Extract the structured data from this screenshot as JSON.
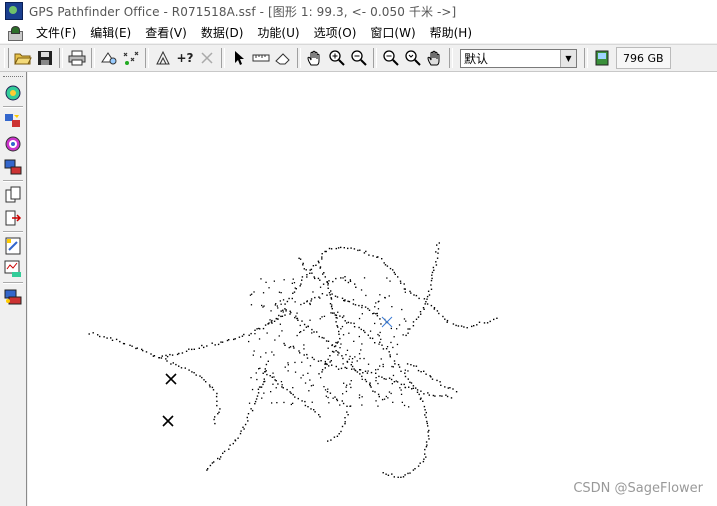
{
  "window": {
    "title": "GPS Pathfinder Office  - R071518A.ssf - [图形 1: 99.3, <- 0.050 千米 ->]"
  },
  "menu": {
    "items": [
      "文件(F)",
      "编辑(E)",
      "查看(V)",
      "数据(D)",
      "功能(U)",
      "选项(O)",
      "窗口(W)",
      "帮助(H)"
    ]
  },
  "toolbar": {
    "buttons": [
      {
        "icon": "open-folder-icon"
      },
      {
        "icon": "save-icon"
      },
      {
        "icon": "print-icon"
      },
      {
        "icon": "layers-icon"
      },
      {
        "icon": "waypoints-icon"
      },
      {
        "icon": "feature-properties-icon"
      },
      {
        "icon": "position-properties-icon"
      },
      {
        "icon": "delete-icon"
      },
      {
        "icon": "select-arrow-icon"
      },
      {
        "icon": "measure-ruler-icon"
      },
      {
        "icon": "eraser-icon"
      },
      {
        "icon": "pan-hand-icon"
      },
      {
        "icon": "zoom-in-icon"
      },
      {
        "icon": "zoom-out-icon"
      },
      {
        "icon": "zoom-extents-icon"
      },
      {
        "icon": "zoom-previous-icon"
      },
      {
        "icon": "pan-auto-icon"
      }
    ],
    "help_label": "+?",
    "layer_select": {
      "value": "默认"
    },
    "memory_label": "796 GB",
    "memory_icon": "memory-card-icon"
  },
  "left_toolbar": {
    "buttons": [
      {
        "icon": "gps-receiver-icon"
      },
      {
        "icon": "differential-correction-icon"
      },
      {
        "icon": "target-icon"
      },
      {
        "icon": "data-transfer-icon"
      },
      {
        "icon": "combine-files-icon"
      },
      {
        "icon": "export-icon"
      },
      {
        "icon": "data-dictionary-icon"
      },
      {
        "icon": "quality-check-icon"
      },
      {
        "icon": "utilities-icon"
      }
    ]
  },
  "map": {
    "markers": [
      {
        "icon": "x-marker-icon",
        "color": "#000000"
      },
      {
        "icon": "x-marker-icon",
        "color": "#000000"
      },
      {
        "icon": "x-marker-icon",
        "color": "#3a7bd5"
      }
    ]
  },
  "watermark": "CSDN @SageFlower",
  "colors": {
    "title_text": "#555555",
    "map_background": "#ffffff",
    "track_points": "#000000",
    "highlight_marker": "#3a7bd5"
  }
}
